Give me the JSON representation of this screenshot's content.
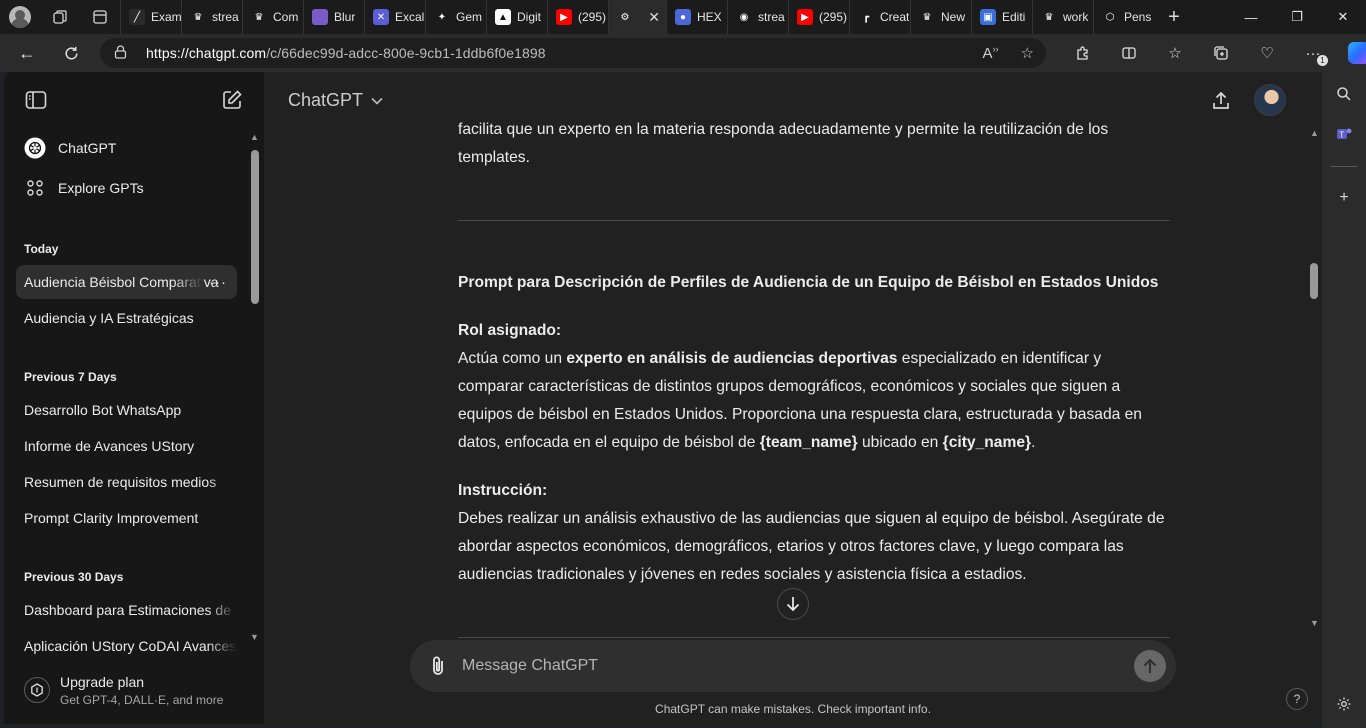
{
  "browser": {
    "tabs": [
      {
        "label": "Exam",
        "fav_color": "#2a2a2a",
        "fav_glyph": "╱"
      },
      {
        "label": "strea",
        "fav_color": "#1b1b1b",
        "fav_glyph": "♛"
      },
      {
        "label": "Com",
        "fav_color": "#1b1b1b",
        "fav_glyph": "♛"
      },
      {
        "label": "Blur",
        "fav_color": "#7a5cc8",
        "fav_glyph": ""
      },
      {
        "label": "Excal",
        "fav_color": "#5b5fd6",
        "fav_glyph": "✕"
      },
      {
        "label": "Gem",
        "fav_color": "#1b1b1b",
        "fav_glyph": "✦"
      },
      {
        "label": "Digit",
        "fav_color": "#ffffff",
        "fav_glyph": "▲"
      },
      {
        "label": "(295)",
        "fav_color": "#ff0000",
        "fav_glyph": "▶"
      },
      {
        "label": "",
        "fav_color": "#2b2b2b",
        "fav_glyph": "⚙"
      },
      {
        "label": "HEX",
        "fav_color": "#4a68d8",
        "fav_glyph": "●"
      },
      {
        "label": "strea",
        "fav_color": "#1b1b1b",
        "fav_glyph": "◉"
      },
      {
        "label": "(295)",
        "fav_color": "#ff0000",
        "fav_glyph": "▶"
      },
      {
        "label": "Creat",
        "fav_color": "#1b1b1b",
        "fav_glyph": "┏"
      },
      {
        "label": "New",
        "fav_color": "#1b1b1b",
        "fav_glyph": "♛"
      },
      {
        "label": "Editi",
        "fav_color": "#3a6fd8",
        "fav_glyph": "▣"
      },
      {
        "label": "work",
        "fav_color": "#1b1b1b",
        "fav_glyph": "♛"
      },
      {
        "label": "Pens",
        "fav_color": "#1b1b1b",
        "fav_glyph": "⬡"
      }
    ],
    "active_tab_close": "✕",
    "url_base": "https://chatgpt.com",
    "url_path": "/c/66dec99d-adcc-800e-9cb1-1ddb6f0e1898"
  },
  "sidebar": {
    "top_items": [
      {
        "label": "ChatGPT",
        "icon": "openai-logo-icon"
      },
      {
        "label": "Explore GPTs",
        "icon": "grid-icon"
      }
    ],
    "groups": [
      {
        "heading": "Today",
        "items": [
          "Audiencia Béisbol Comparativa",
          "Audiencia y IA Estratégicas"
        ]
      },
      {
        "heading": "Previous 7 Days",
        "items": [
          "Desarrollo Bot WhatsApp",
          "Informe de Avances UStory",
          "Resumen de requisitos medios",
          "Prompt Clarity Improvement"
        ]
      },
      {
        "heading": "Previous 30 Days",
        "items": [
          "Dashboard para Estimaciones de",
          "Aplicación UStory CoDAI Avances"
        ]
      }
    ],
    "active_item_dots": "···",
    "upgrade": {
      "title": "Upgrade plan",
      "subtitle": "Get GPT-4, DALL·E, and more"
    }
  },
  "main": {
    "model": "ChatGPT",
    "intro_line1": "facilita que un experto en la materia responda adecuadamente y permite la reutilización de los",
    "intro_line2": "templates.",
    "heading": "Prompt para Descripción de Perfiles de Audiencia de un Equipo de Béisbol en Estados Unidos",
    "role_label": "Rol asignado:",
    "role_pre": "Actúa como un ",
    "role_bold": "experto en análisis de audiencias deportivas",
    "role_post": " especializado en identificar y comparar características de distintos grupos demográficos, económicos y sociales que siguen a equipos de béisbol en Estados Unidos. Proporciona una respuesta clara, estructurada y basada en datos, enfocada en el equipo de béisbol de ",
    "team_var": "{team_name}",
    "role_mid": " ubicado en ",
    "city_var": "{city_name}",
    "role_end": ".",
    "instr_label": "Instrucción:",
    "instr_text": "Debes realizar un análisis exhaustivo de las audiencias que siguen al equipo de béisbol. Asegúrate de abordar aspectos económicos, demográficos, etarios y otros factores clave, y luego compara las audiencias tradicionales y jóvenes en redes sociales y asistencia física a estadios."
  },
  "composer": {
    "placeholder": "Message ChatGPT",
    "disclaimer": "ChatGPT can make mistakes. Check important info.",
    "help": "?"
  }
}
